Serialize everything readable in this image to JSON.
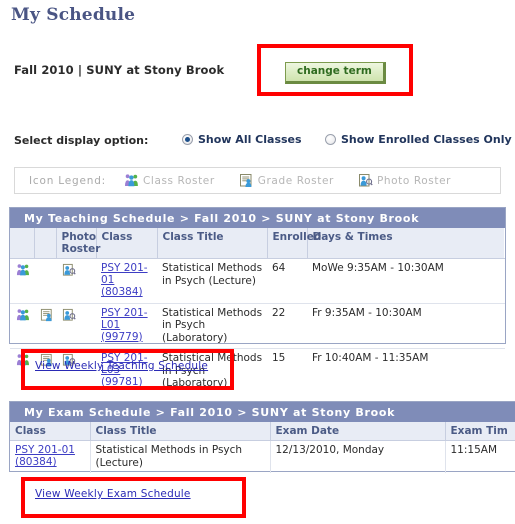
{
  "page": {
    "title": "My Schedule",
    "term_line": "Fall 2010 | SUNY at Stony Brook",
    "change_term_label": "change term"
  },
  "display_options": {
    "label": "Select display option:",
    "options": [
      {
        "label": "Show All Classes",
        "selected": true
      },
      {
        "label": "Show Enrolled Classes Only",
        "selected": false
      }
    ]
  },
  "legend": {
    "title": "Icon Legend:",
    "items": [
      {
        "label": "Class Roster",
        "icon": "class-roster-icon"
      },
      {
        "label": "Grade Roster",
        "icon": "grade-roster-icon"
      },
      {
        "label": "Photo Roster",
        "icon": "photo-roster-icon"
      }
    ]
  },
  "teaching_schedule": {
    "header": "My Teaching Schedule > Fall 2010 > SUNY at Stony Brook",
    "columns": [
      "",
      "",
      "Photo Roster",
      "Class",
      "Class Title",
      "Enrolled",
      "Days & Times"
    ],
    "rows": [
      {
        "class_roster_icon": true,
        "grade_roster_icon": false,
        "photo_roster_icon": true,
        "class_line1": "PSY 201-01",
        "class_line2": "(80384)",
        "title": "Statistical Methods in Psych (Lecture)",
        "enrolled": "64",
        "days_times": "MoWe 9:35AM - 10:30AM"
      },
      {
        "class_roster_icon": true,
        "grade_roster_icon": true,
        "photo_roster_icon": true,
        "class_line1": "PSY 201-L01",
        "class_line2": "(99779)",
        "title": "Statistical Methods in Psych (Laboratory)",
        "enrolled": "22",
        "days_times": "Fr 9:35AM - 10:30AM"
      },
      {
        "class_roster_icon": true,
        "grade_roster_icon": true,
        "photo_roster_icon": true,
        "class_line1": "PSY 201-L03",
        "class_line2": "(99781)",
        "title": "Statistical Methods in Psych (Laboratory)",
        "enrolled": "15",
        "days_times": "Fr 10:40AM - 11:35AM"
      }
    ],
    "weekly_link": "View Weekly Teaching Schedule"
  },
  "exam_schedule": {
    "header": "My Exam Schedule > Fall 2010 > SUNY at Stony Brook",
    "columns": [
      "Class",
      "Class Title",
      "Exam Date",
      "Exam Tim"
    ],
    "rows": [
      {
        "class_line1": "PSY 201-01",
        "class_line2": "(80384)",
        "title": "Statistical Methods in Psych (Lecture)",
        "exam_date": "12/13/2010, Monday",
        "exam_time": "11:15AM"
      }
    ],
    "weekly_link": "View Weekly Exam Schedule"
  },
  "colors": {
    "section_header_bg": "#7f8cb8",
    "column_header_bg": "#e8ecf5",
    "title_color": "#4a5584",
    "link_color": "#3d3dc4",
    "annotation_red": "#ff0000",
    "button_green": "#cfe4ae"
  }
}
